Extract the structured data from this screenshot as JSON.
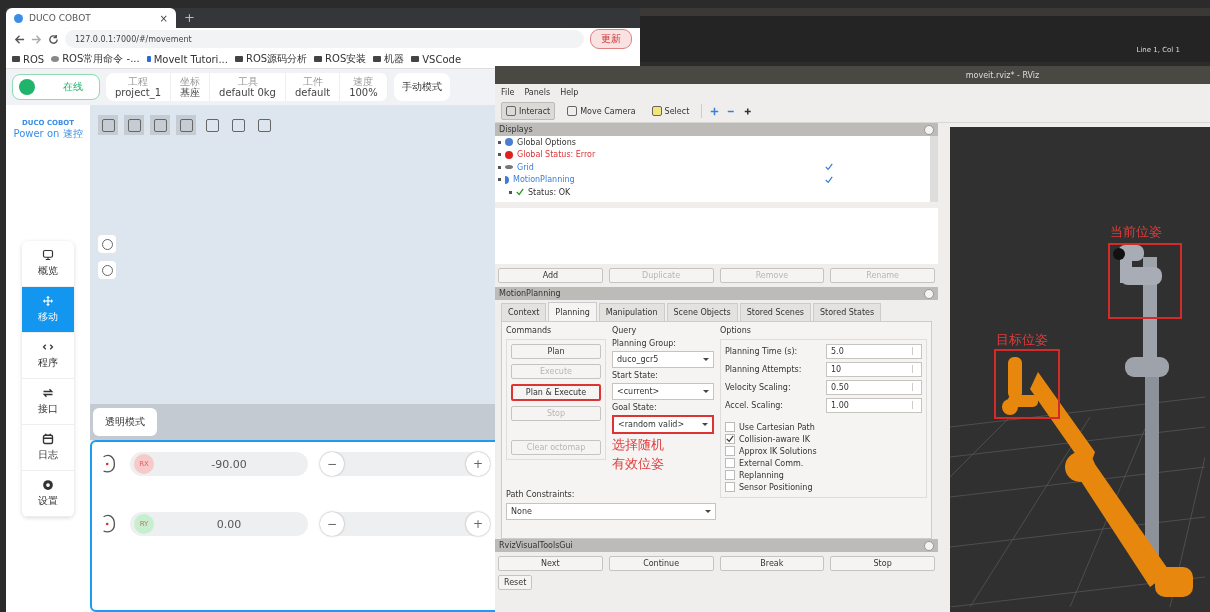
{
  "browser": {
    "tab_title": "DUCO COBOT",
    "tab_close": "×",
    "new_tab": "+",
    "url": "127.0.0.1:7000/#/movement",
    "update_button": "更新",
    "bookmarks": [
      {
        "label": "ROS",
        "kind": "folder"
      },
      {
        "label": "ROS常用命令 -...",
        "kind": "page"
      },
      {
        "label": "MoveIt Tutori...",
        "kind": "link"
      },
      {
        "label": "ROS源码分析",
        "kind": "folder"
      },
      {
        "label": "ROS安装",
        "kind": "folder"
      },
      {
        "label": "机器",
        "kind": "folder"
      },
      {
        "label": "VSCode",
        "kind": "folder"
      }
    ]
  },
  "app": {
    "status": "在线",
    "info": [
      {
        "caption": "工程",
        "value": "project_1"
      },
      {
        "caption": "坐标",
        "value": "基座"
      },
      {
        "caption": "工具",
        "value": "default  0kg"
      },
      {
        "caption": "工件",
        "value": "default"
      },
      {
        "caption": "速度",
        "value": "100%"
      }
    ],
    "mode": "手动模式",
    "logo": "DUCO COBOT",
    "logo_sub": "Power on 速控",
    "nav": [
      {
        "label": "概览",
        "kind": "monitor",
        "selected": false
      },
      {
        "label": "移动",
        "kind": "move",
        "selected": true
      },
      {
        "label": "程序",
        "kind": "code",
        "selected": false
      },
      {
        "label": "接口",
        "kind": "swap",
        "selected": false
      },
      {
        "label": "日志",
        "kind": "calendar",
        "selected": false
      },
      {
        "label": "设置",
        "kind": "gear",
        "selected": false
      }
    ],
    "view_mode": "透明模式",
    "jog": [
      {
        "axis": "RX",
        "color": "#f8c9c9",
        "value": "-90.00",
        "minus": "−",
        "plus": "+"
      },
      {
        "axis": "RY",
        "color": "#c6efd0",
        "value": "0.00",
        "minus": "−",
        "plus": "+"
      }
    ]
  },
  "editor": {
    "cursor": "Line 1, Col 1"
  },
  "rviz": {
    "title": "moveit.rviz* - RViz",
    "menu": [
      "File",
      "Panels",
      "Help"
    ],
    "tools": [
      {
        "label": "Interact",
        "kind": "hand",
        "selected": true
      },
      {
        "label": "Move Camera",
        "kind": "camera",
        "selected": false
      },
      {
        "label": "Select",
        "kind": "select",
        "selected": false
      }
    ],
    "displays": {
      "title": "Displays",
      "items": [
        {
          "label": "Global Options",
          "kind": "options"
        },
        {
          "label": "Global Status: Error",
          "kind": "error"
        },
        {
          "label": "Grid",
          "kind": "grid",
          "checked": true
        },
        {
          "label": "MotionPlanning",
          "kind": "plugin",
          "checked": true,
          "children": [
            {
              "label": "Status: OK",
              "kind": "ok"
            }
          ]
        }
      ],
      "buttons": [
        {
          "label": "Add",
          "disabled": false
        },
        {
          "label": "Duplicate",
          "disabled": true
        },
        {
          "label": "Remove",
          "disabled": true
        },
        {
          "label": "Rename",
          "disabled": true
        }
      ]
    },
    "motion_planning": {
      "title": "MotionPlanning",
      "tabs": [
        {
          "label": "Context",
          "selected": false
        },
        {
          "label": "Planning",
          "selected": true
        },
        {
          "label": "Manipulation",
          "selected": false
        },
        {
          "label": "Scene Objects",
          "selected": false
        },
        {
          "label": "Stored Scenes",
          "selected": false
        },
        {
          "label": "Stored States",
          "selected": false
        }
      ],
      "commands_title": "Commands",
      "commands": [
        {
          "label": "Plan",
          "disabled": false,
          "highlighted": false
        },
        {
          "label": "Execute",
          "disabled": true,
          "highlighted": false
        },
        {
          "label": "Plan & Execute",
          "disabled": false,
          "highlighted": true
        },
        {
          "label": "Stop",
          "disabled": true,
          "highlighted": false
        },
        {
          "label": "Clear octomap",
          "disabled": true,
          "highlighted": false
        }
      ],
      "query_title": "Query",
      "query": [
        {
          "label": "Planning Group:",
          "value": "duco_gcr5",
          "highlighted": false
        },
        {
          "label": "Start State:",
          "value": "<current>",
          "highlighted": false
        },
        {
          "label": "Goal State:",
          "value": "<random valid>",
          "highlighted": true
        }
      ],
      "annotation": [
        "选择随机",
        "有效位姿"
      ],
      "options_title": "Options",
      "spinners": [
        {
          "label": "Planning Time (s):",
          "value": "5.0"
        },
        {
          "label": "Planning Attempts:",
          "value": "10"
        },
        {
          "label": "Velocity Scaling:",
          "value": "0.50"
        },
        {
          "label": "Accel. Scaling:",
          "value": "1.00"
        }
      ],
      "checkboxes": [
        {
          "label": "Use Cartesian Path",
          "checked": false
        },
        {
          "label": "Collision-aware IK",
          "checked": true
        },
        {
          "label": "Approx IK Solutions",
          "checked": false
        },
        {
          "label": "External Comm.",
          "checked": false
        },
        {
          "label": "Replanning",
          "checked": false
        },
        {
          "label": "Sensor Positioning",
          "checked": false
        }
      ],
      "path_constraints": "Path Constraints:",
      "path_value": "None"
    },
    "visual_tools": {
      "title": "RvizVisualToolsGui",
      "buttons": [
        "Next",
        "Continue",
        "Break",
        "Stop"
      ]
    },
    "reset": "Reset",
    "view_labels": [
      "当前位姿",
      "目标位姿"
    ]
  }
}
